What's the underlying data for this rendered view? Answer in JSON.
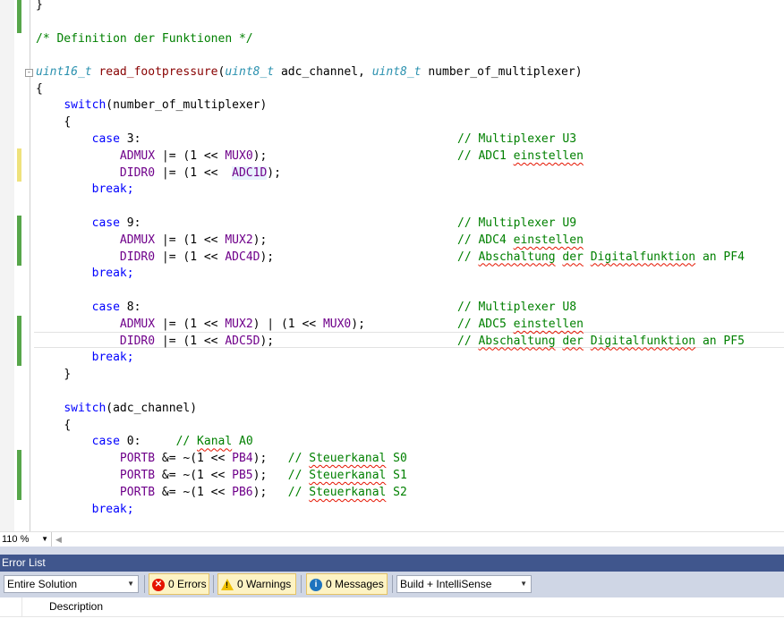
{
  "editor": {
    "lines": {
      "l0": "}",
      "l2": "/* Definition der Funktionen */",
      "l4_type1": "uint16_t",
      "l4_fn": "read_footpressure",
      "l4_p1": "(",
      "l4_type2": "uint8_t",
      "l4_p2": " adc_channel, ",
      "l4_type3": "uint8_t",
      "l4_p3": " number_of_multiplexer)",
      "l5": "{",
      "l6_kw": "switch",
      "l6_rest": "(number_of_multiplexer)",
      "l7": "{",
      "l8_kw": "case",
      "l8_rest": " 3:",
      "l9_a": "ADMUX",
      "l9_b": " |= (1 << ",
      "l9_c": "MUX0",
      "l9_d": ");",
      "l10_a": "DIDR0",
      "l10_b": " |= (1 <<  ",
      "l10_c": "ADC1D",
      "l10_d": ");",
      "l11": "break;",
      "l13_kw": "case",
      "l13_rest": " 9:",
      "l14_a": "ADMUX",
      "l14_b": " |= (1 << ",
      "l14_c": "MUX2",
      "l14_d": ");",
      "l15_a": "DIDR0",
      "l15_b": " |= (1 << ",
      "l15_c": "ADC4D",
      "l15_d": ");",
      "l16": "break;",
      "l18_kw": "case",
      "l18_rest": " 8:",
      "l19_a": "ADMUX",
      "l19_b": " |= (1 << ",
      "l19_c": "MUX2",
      "l19_d": ") | (1 << ",
      "l19_e": "MUX0",
      "l19_f": ");",
      "l20_a": "DIDR0",
      "l20_b": " |= (1 << ",
      "l20_c": "ADC5D",
      "l20_d": ");",
      "l21": "break;",
      "l22": "}",
      "l24_kw": "switch",
      "l24_rest": "(adc_channel)",
      "l25": "{",
      "l26_kw": "case",
      "l26_rest": " 0:     ",
      "l26_cm1": "// ",
      "l26_cm2": "Kanal",
      "l26_cm3": " A0",
      "l27_a": "PORTB",
      "l27_b": " &= ~(1 << ",
      "l27_c": "PB4",
      "l27_d": ");   ",
      "l27_e": "// ",
      "l27_f": "Steuerkanal",
      "l27_g": " S0",
      "l28_a": "PORTB",
      "l28_b": " &= ~(1 << ",
      "l28_c": "PB5",
      "l28_d": ");   ",
      "l28_e": "// ",
      "l28_f": "Steuerkanal",
      "l28_g": " S1",
      "l29_a": "PORTB",
      "l29_b": " &= ~(1 << ",
      "l29_c": "PB6",
      "l29_d": ");   ",
      "l29_e": "// ",
      "l29_f": "Steuerkanal",
      "l29_g": " S2",
      "l30": "break;"
    },
    "comments": {
      "c8": "// Multiplexer U3",
      "c9_a": "// ADC1 ",
      "c9_b": "einstellen",
      "c13": "// Multiplexer U9",
      "c14_a": "// ADC4 ",
      "c14_b": "einstellen",
      "c15_a": "// ",
      "c15_b": "Abschaltung",
      "c15_c": " ",
      "c15_d": "der",
      "c15_e": " ",
      "c15_f": "Digitalfunktion",
      "c15_g": " an PF4",
      "c18": "// Multiplexer U8",
      "c19_a": "// ADC5 ",
      "c19_b": "einstellen",
      "c20_a": "// ",
      "c20_b": "Abschaltung",
      "c20_c": " ",
      "c20_d": "der",
      "c20_e": " ",
      "c20_f": "Digitalfunktion",
      "c20_g": " an PF5"
    },
    "outline_toggle": "-"
  },
  "statusbar": {
    "zoom": "110 %"
  },
  "error_list": {
    "title": "Error List",
    "scope": "Entire Solution",
    "errors": "0 Errors",
    "warnings": "0 Warnings",
    "messages": "0 Messages",
    "build_filter": "Build + IntelliSense",
    "column_description": "Description"
  },
  "colors": {
    "keyword": "#0000ff",
    "type": "#2b91af",
    "function": "#880000",
    "macro": "#6f008a",
    "comment": "#008000",
    "error_list_title": "#40568d"
  }
}
